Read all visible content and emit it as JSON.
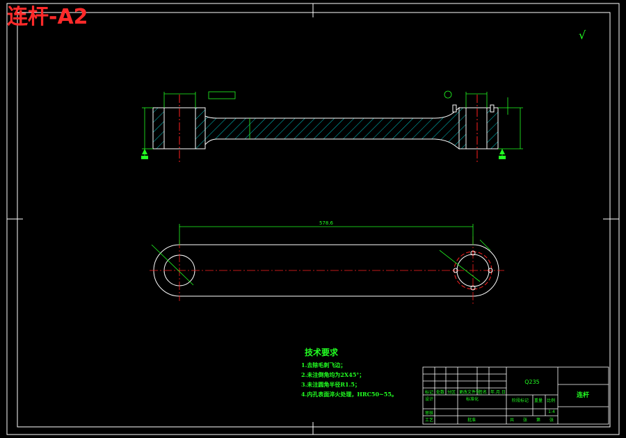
{
  "sheet_title": "连杆-A2",
  "colors": {
    "background": "#000000",
    "frame": "#ffffff",
    "dimension": "#22ff22",
    "centerline": "#ff2020",
    "hatch": "#00cccc",
    "title_stamp": "#ff2a2a"
  },
  "front_view": {
    "length_dim": "578.6"
  },
  "surface_symbol": "√",
  "technical_requirements": {
    "title": "技术要求",
    "items": [
      "1.去除毛刺飞边；",
      "2.未注倒角均为2X45°；",
      "3.未注圆角半径R1.5；",
      "4.内孔表面淬火处理，HRC50~55。"
    ]
  },
  "title_block": {
    "material": "Q235",
    "part_name": "连杆",
    "labels": [
      "标记",
      "处数",
      "分区",
      "更改文件号",
      "签名",
      "年.月.日",
      "设计",
      "标准化",
      "阶段标记",
      "重量",
      "比例",
      "审核",
      "工艺",
      "批准",
      "共",
      "张",
      "第",
      "张"
    ],
    "scale": "1:4"
  }
}
